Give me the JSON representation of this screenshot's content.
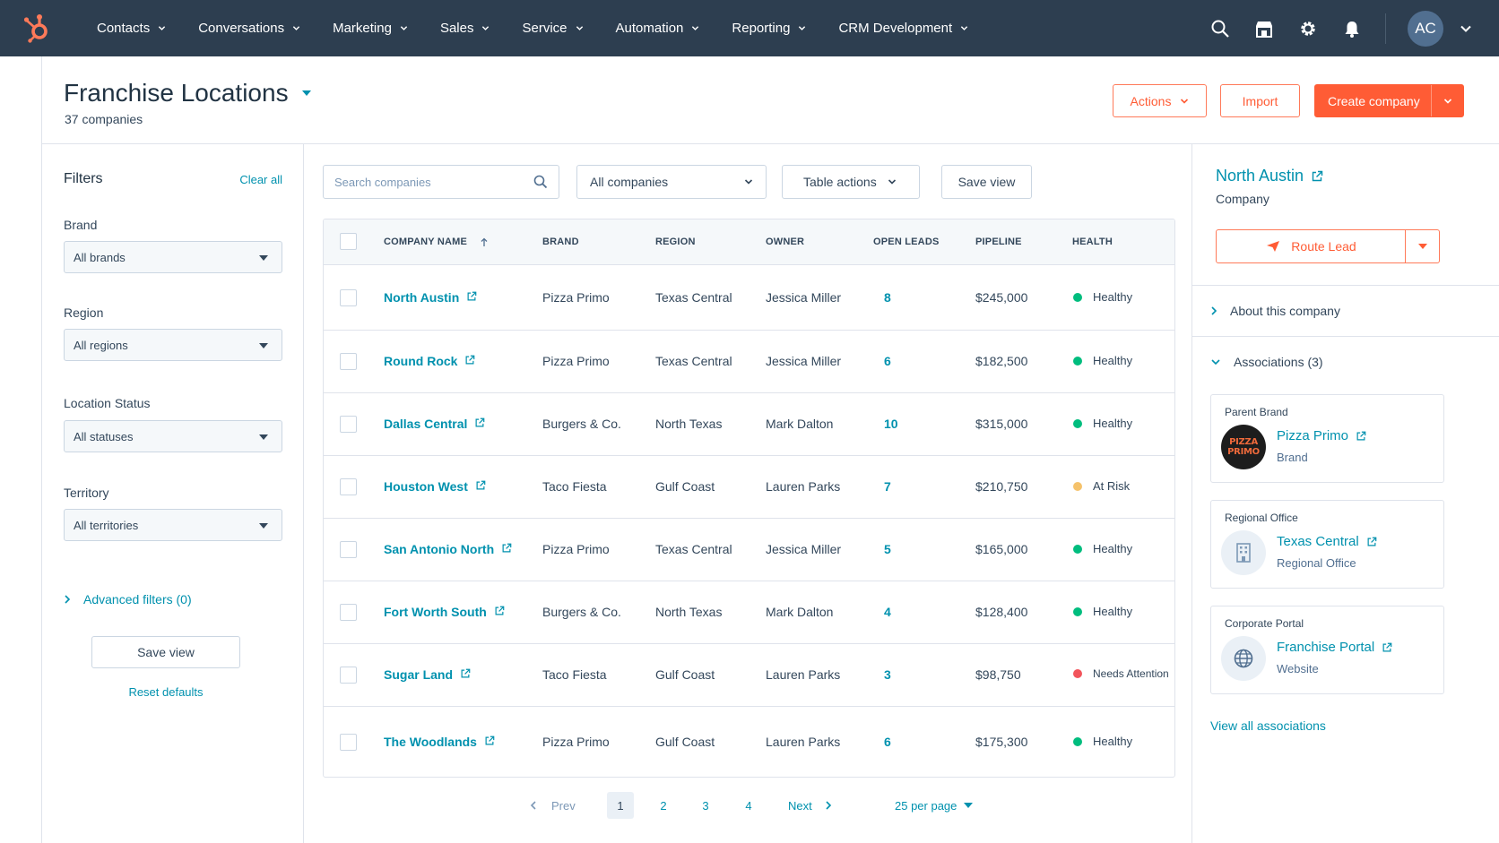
{
  "nav": {
    "items": [
      {
        "label": "Contacts"
      },
      {
        "label": "Conversations"
      },
      {
        "label": "Marketing"
      },
      {
        "label": "Sales"
      },
      {
        "label": "Service"
      },
      {
        "label": "Automation"
      },
      {
        "label": "Reporting"
      },
      {
        "label": "CRM Development"
      }
    ],
    "avatar_initials": "AC",
    "icons": [
      "search-icon",
      "marketplace-icon",
      "settings-gear-icon",
      "notification-bell-icon"
    ]
  },
  "header": {
    "title": "Franchise Locations",
    "subtitle": "37 companies",
    "actions_label": "Actions",
    "import_label": "Import",
    "create_label": "Create company"
  },
  "filters": {
    "title": "Filters",
    "clear_label": "Clear all",
    "brand": {
      "label": "Brand",
      "value": "All brands"
    },
    "region": {
      "label": "Region",
      "value": "All regions"
    },
    "status": {
      "label": "Location Status",
      "value": "All statuses"
    },
    "territory": {
      "label": "Territory",
      "value": "All territories"
    },
    "advanced_label": "Advanced filters (0)",
    "save_label": "Save view",
    "reset_label": "Reset defaults"
  },
  "toolbar": {
    "search_placeholder": "Search companies",
    "view_select": "All companies",
    "table_actions": "Table actions",
    "save_view": "Save view"
  },
  "table": {
    "headers": {
      "company": "COMPANY NAME",
      "brand": "BRAND",
      "region": "REGION",
      "owner": "OWNER",
      "leads": "OPEN LEADS",
      "pipeline": "PIPELINE",
      "health": "HEALTH"
    },
    "rows": [
      {
        "name": "North Austin",
        "brand": "Pizza Primo",
        "region": "Texas Central",
        "owner": "Jessica Miller",
        "leads": "8",
        "pipeline": "$245,000",
        "health": "Healthy",
        "health_color": "#00bd7e"
      },
      {
        "name": "Round Rock",
        "brand": "Pizza Primo",
        "region": "Texas Central",
        "owner": "Jessica Miller",
        "leads": "6",
        "pipeline": "$182,500",
        "health": "Healthy",
        "health_color": "#00bd7e"
      },
      {
        "name": "Dallas Central",
        "brand": "Burgers & Co.",
        "region": "North Texas",
        "owner": "Mark Dalton",
        "leads": "10",
        "pipeline": "$315,000",
        "health": "Healthy",
        "health_color": "#00bd7e"
      },
      {
        "name": "Houston West",
        "brand": "Taco Fiesta",
        "region": "Gulf Coast",
        "owner": "Lauren Parks",
        "leads": "7",
        "pipeline": "$210,750",
        "health": "At Risk",
        "health_color": "#f5c26b"
      },
      {
        "name": "San Antonio North",
        "brand": "Pizza Primo",
        "region": "Texas Central",
        "owner": "Jessica Miller",
        "leads": "5",
        "pipeline": "$165,000",
        "health": "Healthy",
        "health_color": "#00bd7e"
      },
      {
        "name": "Fort Worth South",
        "brand": "Burgers & Co.",
        "region": "North Texas",
        "owner": "Mark Dalton",
        "leads": "4",
        "pipeline": "$128,400",
        "health": "Healthy",
        "health_color": "#00bd7e"
      },
      {
        "name": "Sugar Land",
        "brand": "Taco Fiesta",
        "region": "Gulf Coast",
        "owner": "Lauren Parks",
        "leads": "3",
        "pipeline": "$98,750",
        "health": "Needs Attention",
        "health_color": "#f2545b"
      },
      {
        "name": "The Woodlands",
        "brand": "Pizza Primo",
        "region": "Gulf Coast",
        "owner": "Lauren Parks",
        "leads": "6",
        "pipeline": "$175,300",
        "health": "Healthy",
        "health_color": "#00bd7e"
      }
    ]
  },
  "pagination": {
    "prev": "Prev",
    "pages": [
      "1",
      "2",
      "3",
      "4"
    ],
    "current": "1",
    "next": "Next",
    "per_page": "25 per page"
  },
  "record": {
    "name": "North Austin",
    "type": "Company",
    "route_label": "Route Lead",
    "about_label": "About this company",
    "assoc_label": "Associations (3)",
    "cards": [
      {
        "type": "Parent Brand",
        "name": "Pizza Primo",
        "sub": "Brand",
        "logo_text": "PIZZA PRIMO"
      },
      {
        "type": "Regional Office",
        "name": "Texas Central",
        "sub": "Regional Office"
      },
      {
        "type": "Corporate Portal",
        "name": "Franchise Portal",
        "sub": "Website"
      }
    ],
    "view_all": "View all associations"
  },
  "colors": {
    "nav_bg": "#2d3e50",
    "accent_orange": "#ff5c35",
    "link_teal": "#0091ae",
    "healthy": "#00bd7e",
    "at_risk": "#f5c26b",
    "needs_attention": "#f2545b"
  }
}
